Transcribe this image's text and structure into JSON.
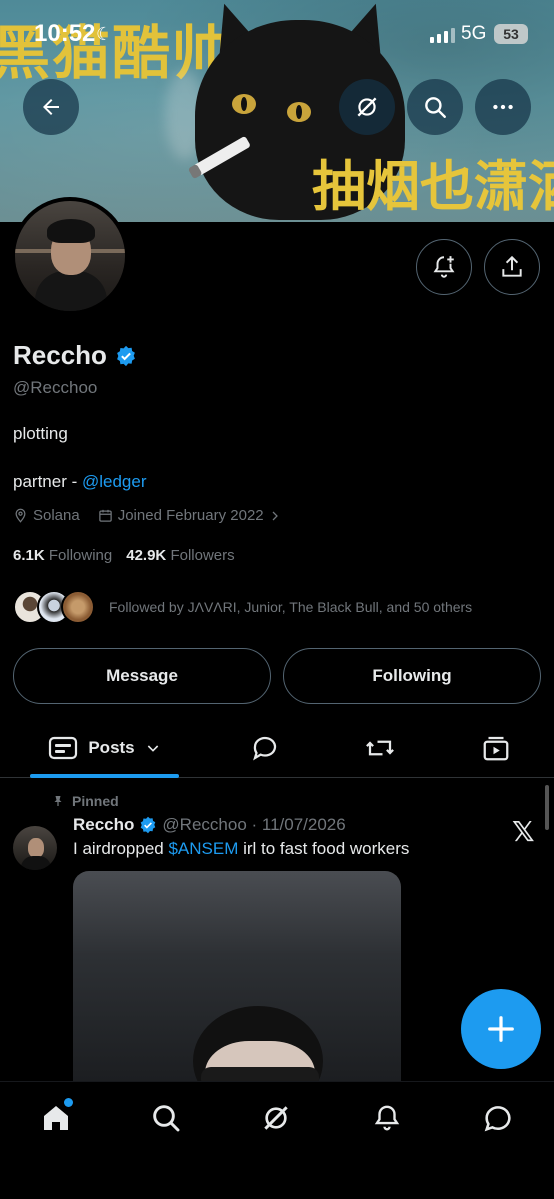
{
  "status_bar": {
    "time": "10:52",
    "network": "5G",
    "battery": "53"
  },
  "banner": {
    "top_text": "黑猫酷帅",
    "bottom_text": "抽烟也潇洒"
  },
  "profile": {
    "display_name": "Reccho",
    "handle": "@Recchoo",
    "bio_line1": "plotting",
    "bio_partner_prefix": "partner - ",
    "bio_partner_link": "@ledger",
    "location": "Solana",
    "joined": "Joined February 2022",
    "following_count": "6.1K",
    "following_label": "Following",
    "followers_count": "42.9K",
    "followers_label": "Followers",
    "followed_by": "Followed by JΛVΛRI, Junior, The Black Bull, and 50 others"
  },
  "actions": {
    "message": "Message",
    "following": "Following"
  },
  "tabs": {
    "posts": "Posts"
  },
  "post": {
    "pinned_label": "Pinned",
    "name": "Reccho",
    "meta": "@Recchoo · 11/07/2026",
    "text_prefix": "I airdropped ",
    "text_link": "$ANSEM",
    "text_suffix": " irl to fast food workers",
    "source_logo": "𝕏"
  },
  "colors": {
    "accent": "#1d9bf0",
    "background": "#000000",
    "secondary_text": "#71767b"
  }
}
